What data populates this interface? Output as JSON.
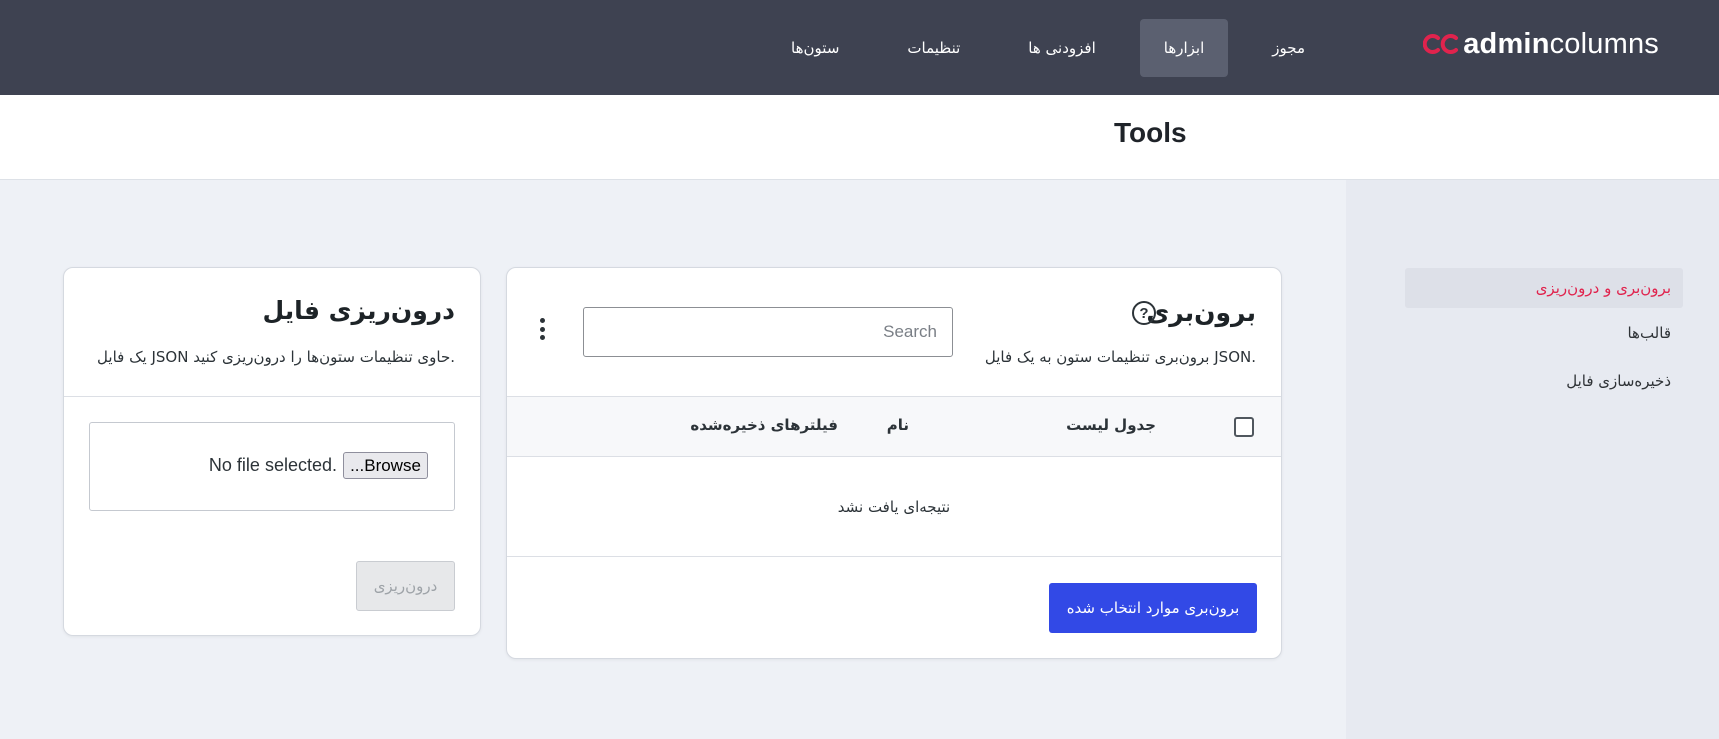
{
  "brand": {
    "prefix": "admin",
    "suffix": "columns",
    "accent": "#e0234d"
  },
  "nav": {
    "items": [
      {
        "label": "ستون‌ها",
        "active": false
      },
      {
        "label": "تنظیمات",
        "active": false
      },
      {
        "label": "افزودنی ها",
        "active": false
      },
      {
        "label": "ابزارها",
        "active": true
      },
      {
        "label": "مجوز",
        "active": false
      }
    ]
  },
  "page": {
    "title": "Tools"
  },
  "sidebar": {
    "items": [
      {
        "label": "برون‌بری و درون‌ریزی",
        "active": true
      },
      {
        "label": "قالب‌ها",
        "active": false
      },
      {
        "label": "ذخیره‌سازی فایل",
        "active": false
      }
    ]
  },
  "export": {
    "title": "برون‌بری",
    "help_icon": "?",
    "description": "برون‌بری تنظیمات ستون به یک فایل JSON.",
    "search_placeholder": "Search",
    "columns": {
      "list_table": "جدول لیست",
      "name": "نام",
      "saved_filters": "فیلترهای ذخیره‌شده"
    },
    "empty_message": "نتیجه‌ای یافت نشد",
    "button_label": "برون‌بری موارد انتخاب شده",
    "button_color": "#3249e6"
  },
  "import": {
    "title": "درون‌ریزی فایل",
    "description": "یک فایل JSON حاوی تنظیمات ستون‌ها را درون‌ریزی کنید.",
    "browse_label": "...Browse",
    "file_status": "No file selected.",
    "button_label": "درون‌ریزی"
  }
}
